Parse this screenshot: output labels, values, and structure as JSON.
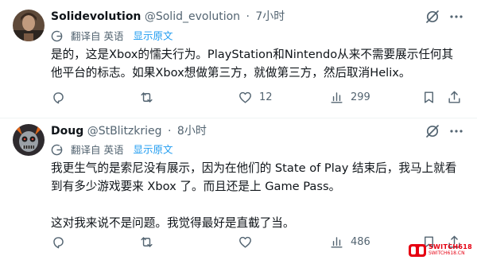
{
  "tweets": [
    {
      "author": {
        "name": "Solidevolution",
        "handle": "@Solid_evolution"
      },
      "time": "7小时",
      "translate_label": "翻译自 英语",
      "show_original": "显示原文",
      "paragraphs": [
        "是的，这是Xbox的懦夫行为。PlayStation和Nintendo从来不需要展示任何其他平台的标志。如果Xbox想做第三方，就做第三方，然后取消Helix。"
      ],
      "stats": {
        "replies": "",
        "retweets": "",
        "likes": "12",
        "views": "299"
      }
    },
    {
      "author": {
        "name": "Doug",
        "handle": "@StBlitzkrieg"
      },
      "time": "8小时",
      "translate_label": "翻译自 英语",
      "show_original": "显示原文",
      "paragraphs": [
        "我更生气的是索尼没有展示，因为在他们的 State of Play 结束后，我马上就看到有多少游戏要来 Xbox 了。而且还是上 Game Pass。",
        "这对我来说不是问题。我觉得最好是直截了当。"
      ],
      "stats": {
        "replies": "",
        "retweets": "",
        "likes": "",
        "views": "486"
      }
    }
  ],
  "dot": "·",
  "watermark": {
    "main": "SWITCH618",
    "sub": "SWITCH618.CN"
  },
  "icons": [
    "grok-icon",
    "more-icon",
    "translate-icon",
    "reply-icon",
    "retweet-icon",
    "like-icon",
    "views-icon",
    "bookmark-icon",
    "share-icon"
  ],
  "colors": {
    "text": "#0f1419",
    "secondary": "#536471",
    "link": "#1d9bf0",
    "divider": "#eff3f4"
  }
}
